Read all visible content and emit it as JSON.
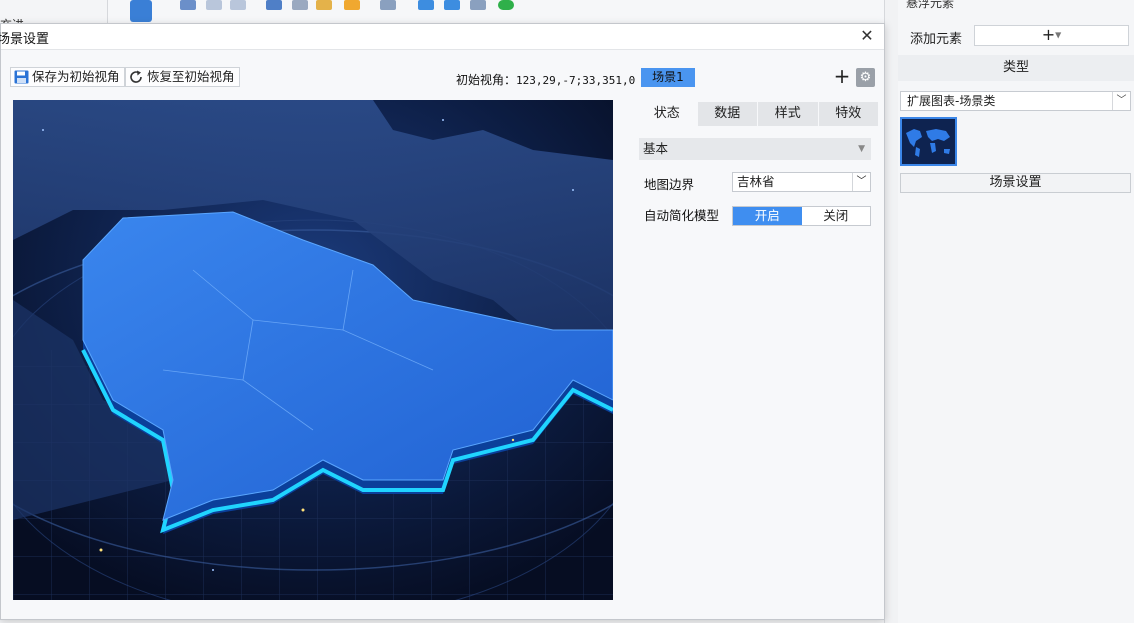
{
  "background": {
    "left_fragment": "充进",
    "right_top_fragment": "悬浮元素"
  },
  "right_panel": {
    "add_element_label": "添加元素",
    "add_button_glyph": "+",
    "type_header": "类型",
    "type_select_value": "扩展图表-场景类",
    "scene_settings_button": "场景设置"
  },
  "dialog": {
    "title": "场景设置",
    "close_glyph": "✕",
    "toolbar": {
      "save_initial_view": "保存为初始视角",
      "restore_initial_view": "恢复至初始视角",
      "initial_view_label": "初始视角：",
      "initial_view_value": "123,29,-7;33,351,0",
      "scene_tab": "场景1",
      "add_glyph": "+",
      "settings_glyph": "⚙"
    },
    "tabs": [
      "状态",
      "数据",
      "样式",
      "特效"
    ],
    "active_tab": "状态",
    "section": "基本",
    "map_boundary_label": "地图边界",
    "map_boundary_value": "吉林省",
    "auto_simplify_label": "自动简化模型",
    "auto_simplify_on": "开启",
    "auto_simplify_off": "关闭",
    "auto_simplify_state": "开启"
  },
  "colors": {
    "accent": "#3f8ef0",
    "map_fill": "#2c6ee0",
    "map_edge": "#19c6ff",
    "preview_bg": "#0a1530"
  }
}
